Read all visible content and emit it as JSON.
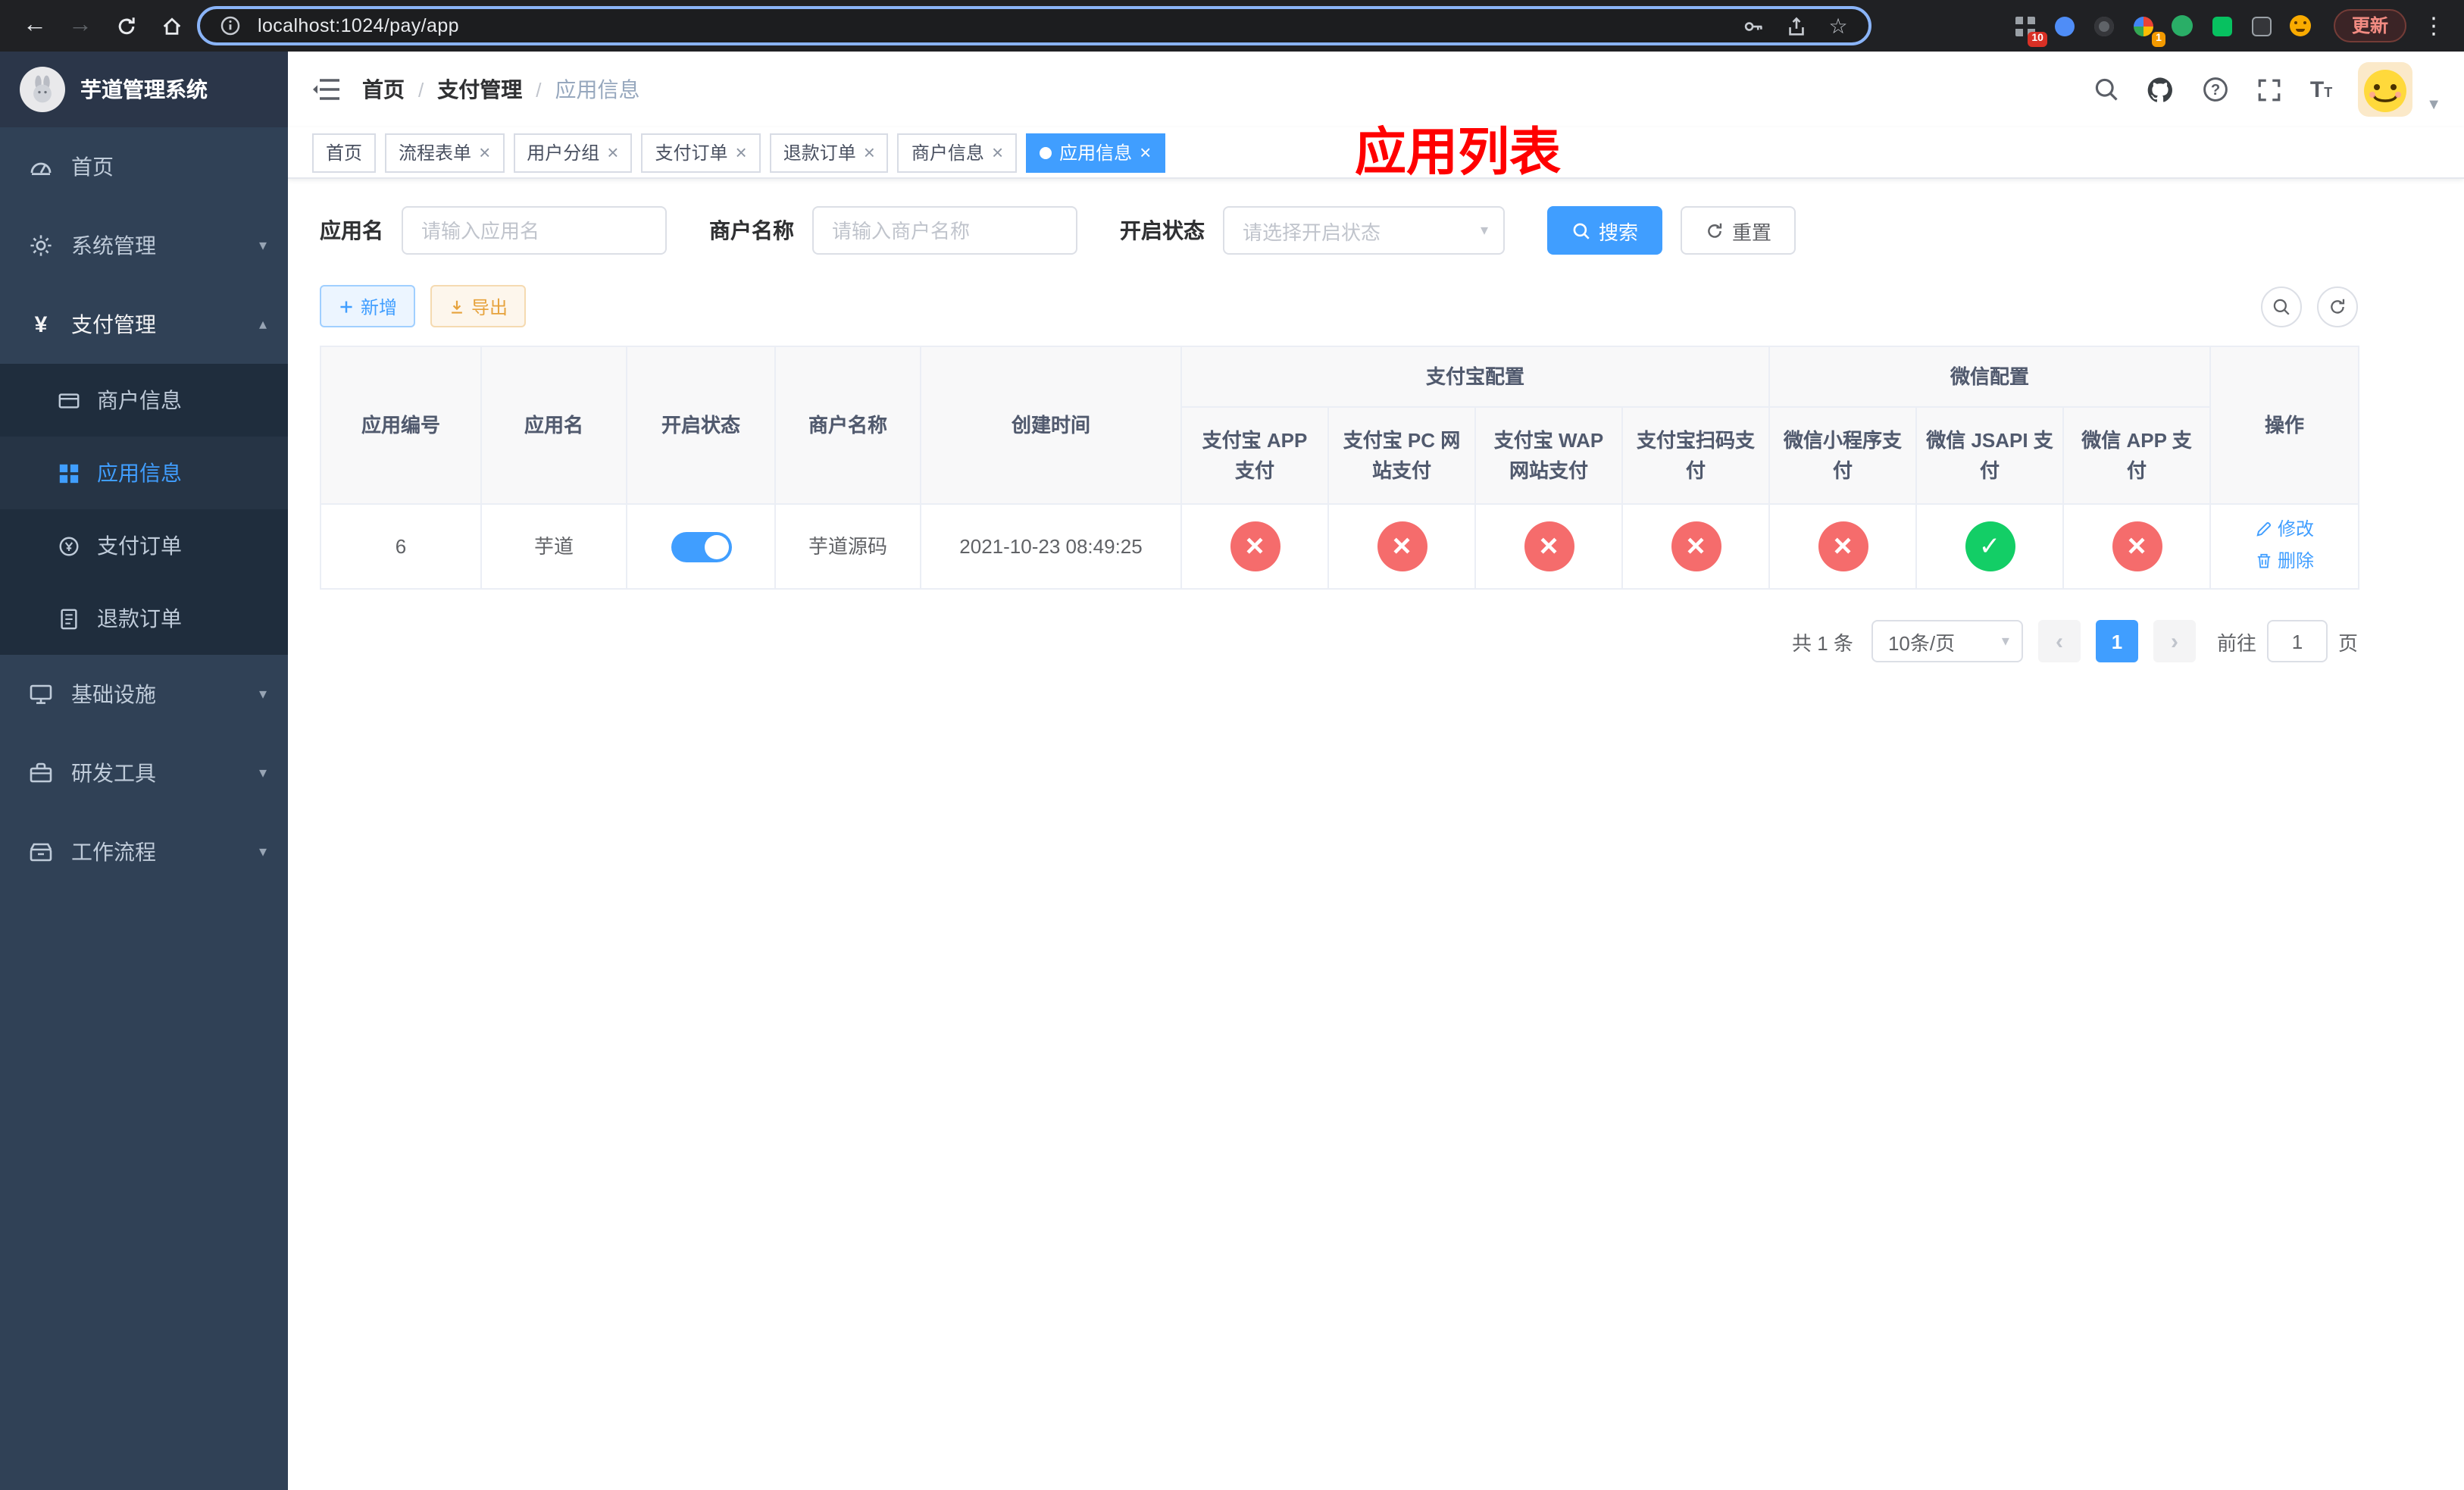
{
  "colors": {
    "accent": "#409eff",
    "success": "#13ce66",
    "danger": "#f56c6c",
    "warning": "#e6a23c",
    "annotation_red": "#ff0000",
    "sidebar_bg": "#304156",
    "submenu_bg": "#1f2d3d",
    "browser_bg": "#202124"
  },
  "browser": {
    "url": "localhost:1024/pay/app",
    "update_label": "更新",
    "extension_badge_count": "10",
    "extension_badge_one": "1"
  },
  "sidebar": {
    "logo_title": "芋道管理系统",
    "items": [
      {
        "label": "首页"
      },
      {
        "label": "系统管理"
      },
      {
        "label": "支付管理"
      },
      {
        "label": "基础设施"
      },
      {
        "label": "研发工具"
      },
      {
        "label": "工作流程"
      }
    ],
    "submenu": [
      {
        "label": "商户信息"
      },
      {
        "label": "应用信息"
      },
      {
        "label": "支付订单"
      },
      {
        "label": "退款订单"
      }
    ]
  },
  "header": {
    "breadcrumb": [
      {
        "label": "首页"
      },
      {
        "label": "支付管理"
      },
      {
        "label": "应用信息"
      }
    ],
    "overlay_title": "应用列表"
  },
  "tabs": [
    {
      "label": "首页"
    },
    {
      "label": "流程表单"
    },
    {
      "label": "用户分组"
    },
    {
      "label": "支付订单"
    },
    {
      "label": "退款订单"
    },
    {
      "label": "商户信息"
    },
    {
      "label": "应用信息"
    }
  ],
  "filters": {
    "app_name_label": "应用名",
    "app_name_placeholder": "请输入应用名",
    "merchant_label": "商户名称",
    "merchant_placeholder": "请输入商户名称",
    "status_label": "开启状态",
    "status_placeholder": "请选择开启状态",
    "search_label": "搜索",
    "reset_label": "重置"
  },
  "toolbar": {
    "add_label": "新增",
    "export_label": "导出"
  },
  "table": {
    "groups": {
      "alipay": "支付宝配置",
      "wechat": "微信配置"
    },
    "columns": {
      "app_id": "应用编号",
      "app_name": "应用名",
      "status": "开启状态",
      "merchant": "商户名称",
      "created": "创建时间",
      "alipay_app": "支付宝 APP 支付",
      "alipay_pc": "支付宝 PC 网站支付",
      "alipay_wap": "支付宝 WAP 网站支付",
      "alipay_qr": "支付宝扫码支付",
      "wx_lite": "微信小程序支付",
      "wx_jsapi": "微信 JSAPI 支付",
      "wx_app": "微信 APP 支付",
      "actions": "操作"
    },
    "rows": [
      {
        "app_id": "6",
        "app_name": "芋道",
        "status": "on",
        "merchant": "芋道源码",
        "created": "2021-10-23 08:49:25",
        "alipay_app": "close",
        "alipay_pc": "close",
        "alipay_wap": "close",
        "alipay_qr": "close",
        "wx_lite": "close",
        "wx_jsapi": "check",
        "wx_app": "close",
        "edit_label": "修改",
        "delete_label": "删除"
      }
    ]
  },
  "pagination": {
    "total_label": "共 1 条",
    "page_size_label": "10条/页",
    "current_page": "1",
    "goto_label": "前往",
    "goto_value": "1",
    "page_unit": "页"
  }
}
